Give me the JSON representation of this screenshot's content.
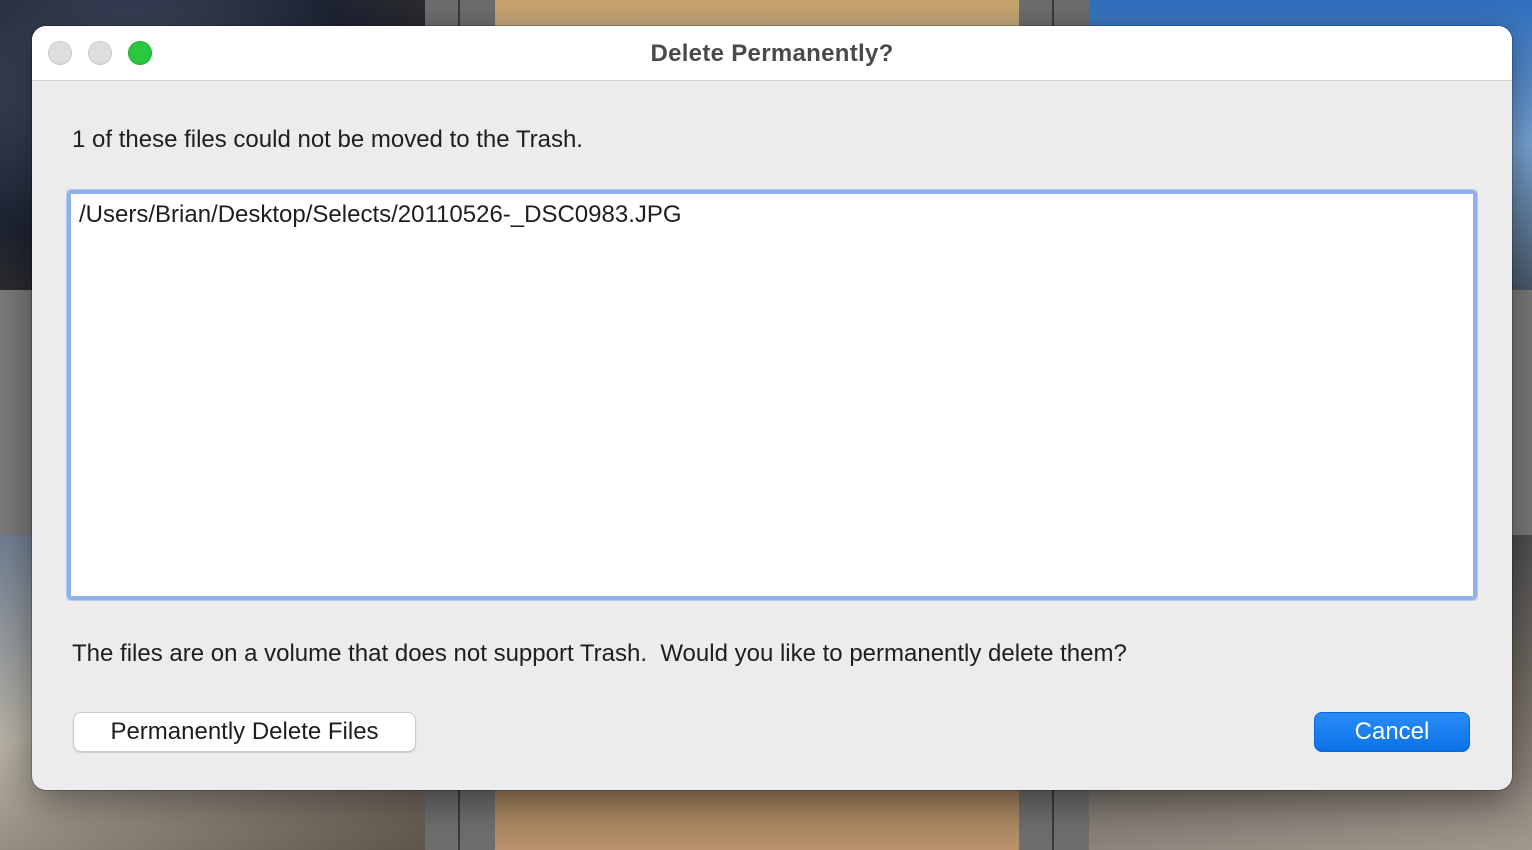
{
  "dialog": {
    "title": "Delete Permanently?",
    "message": "1 of these files could not be moved to the Trash.",
    "files": [
      "/Users/Brian/Desktop/Selects/20110526-_DSC0983.JPG"
    ],
    "question": "The files are on a volume that does not support Trash.  Would you like to permanently delete them?",
    "buttons": {
      "delete_label": "Permanently Delete Files",
      "cancel_label": "Cancel"
    }
  },
  "colors": {
    "accent": "#0a72e8",
    "focus_ring": "#8fb0ea",
    "zoom_button": "#2ac840"
  }
}
